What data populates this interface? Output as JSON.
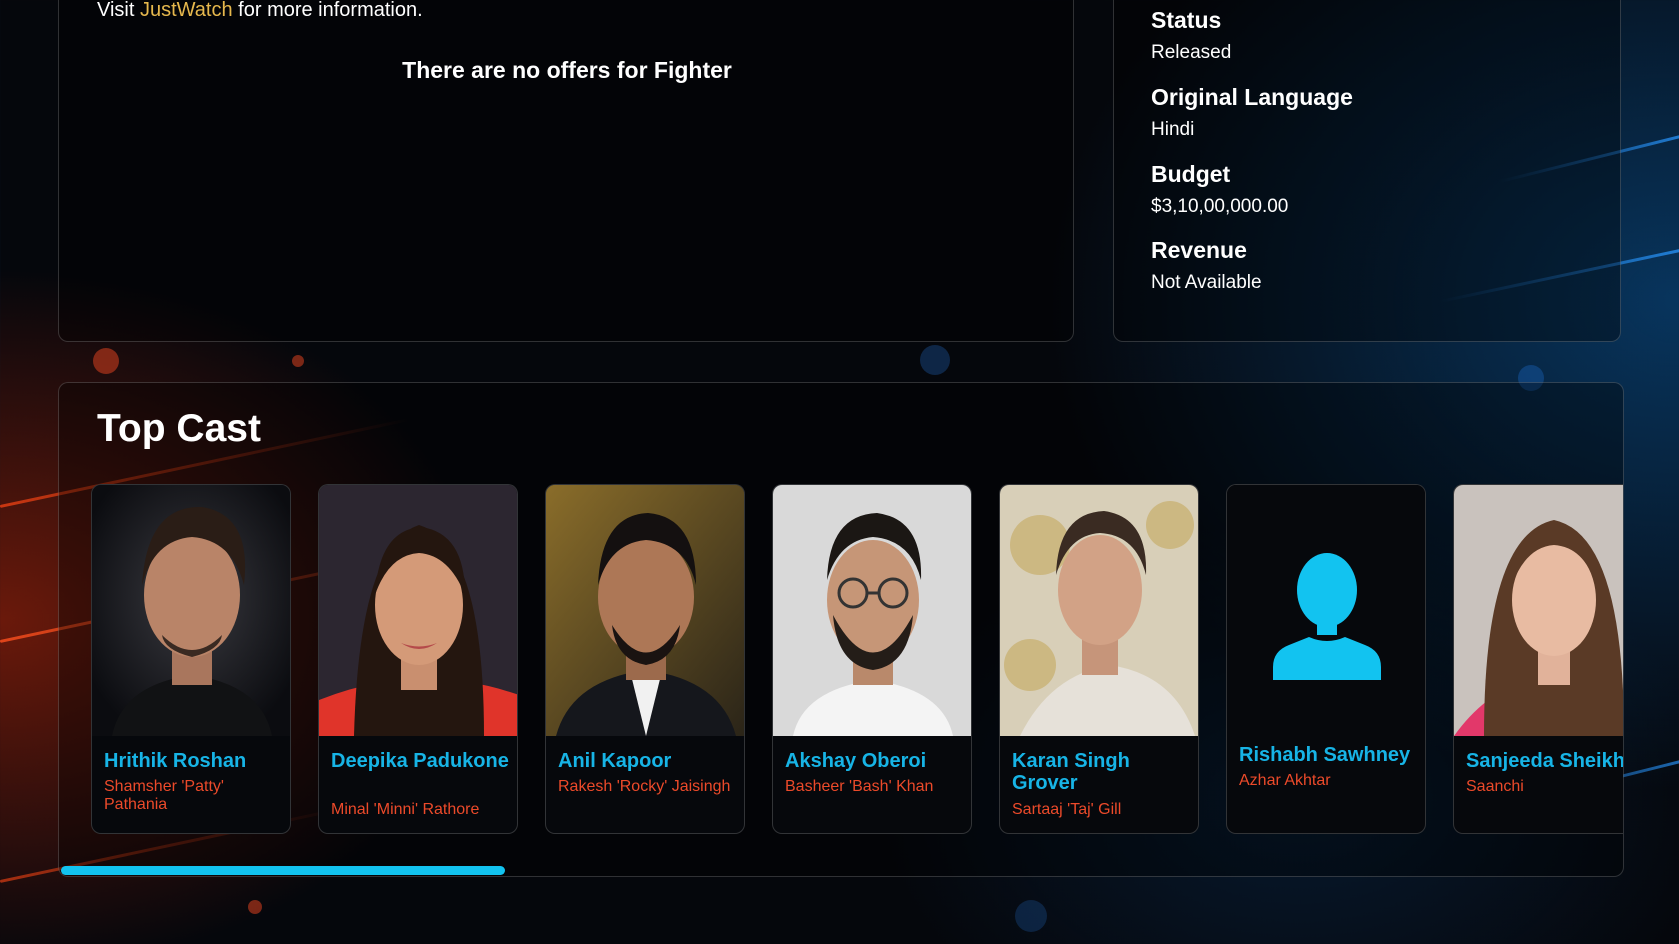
{
  "offers": {
    "visit_prefix": "Visit ",
    "visit_link": "JustWatch",
    "visit_suffix": " for more information.",
    "no_offers_text": "There are no offers for Fighter"
  },
  "facts": [
    {
      "label": "Status",
      "value": "Released"
    },
    {
      "label": "Original Language",
      "value": "Hindi"
    },
    {
      "label": "Budget",
      "value": "$3,10,00,000.00"
    },
    {
      "label": "Revenue",
      "value": "Not Available"
    }
  ],
  "cast": {
    "title": "Top Cast",
    "members": [
      {
        "name": "Hrithik Roshan",
        "role": "Shamsher 'Patty' Pathania"
      },
      {
        "name": "Deepika Padukone",
        "role": "Minal 'Minni' Rathore"
      },
      {
        "name": "Anil Kapoor",
        "role": "Rakesh 'Rocky' Jaisingh"
      },
      {
        "name": "Akshay Oberoi",
        "role": "Basheer 'Bash' Khan"
      },
      {
        "name": "Karan Singh Grover",
        "role": "Sartaaj 'Taj' Gill"
      },
      {
        "name": "Rishabh Sawhney",
        "role": "Azhar Akhtar"
      },
      {
        "name": "Sanjeeda Sheikh",
        "role": "Saanchi"
      }
    ],
    "scroll_position": 0.28
  },
  "colors": {
    "accent_link": "#e6b84d",
    "cast_name": "#17b4e6",
    "cast_role": "#ec4a2a",
    "scrollbar": "#12c3f0",
    "placeholder_icon": "#12c3f0"
  }
}
